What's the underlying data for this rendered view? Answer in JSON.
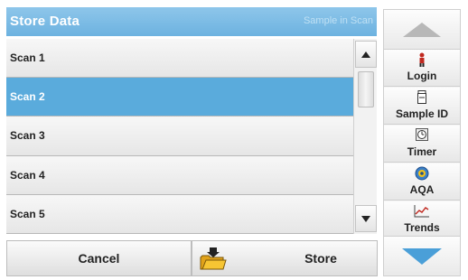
{
  "header": {
    "title": "Store Data",
    "hint": "Sample in Scan"
  },
  "list": {
    "items": [
      {
        "label": "Scan 1",
        "selected": false
      },
      {
        "label": "Scan 2",
        "selected": true
      },
      {
        "label": "Scan 3",
        "selected": false
      },
      {
        "label": "Scan 4",
        "selected": false
      },
      {
        "label": "Scan 5",
        "selected": false
      }
    ]
  },
  "scrollbar": {
    "up_icon": "triangle-up",
    "down_icon": "triangle-down"
  },
  "footer": {
    "cancel_label": "Cancel",
    "store_label": "Store",
    "store_icon": "folder-icon"
  },
  "sidebar": {
    "up_icon": "chevron-up",
    "down_icon": "chevron-down",
    "buttons": [
      {
        "label": "Login",
        "icon": "person-icon"
      },
      {
        "label": "Sample ID",
        "icon": "sample-bottle-icon"
      },
      {
        "label": "Timer",
        "icon": "timer-icon"
      },
      {
        "label": "AQA",
        "icon": "aqa-icon"
      },
      {
        "label": "Trends",
        "icon": "trends-chart-icon"
      }
    ]
  },
  "colors": {
    "accent": "#5aabdc",
    "titlebar": "#7bbce5",
    "nav_arrow_up": "#b8b8b8",
    "nav_arrow_down": "#4a9fd8"
  }
}
